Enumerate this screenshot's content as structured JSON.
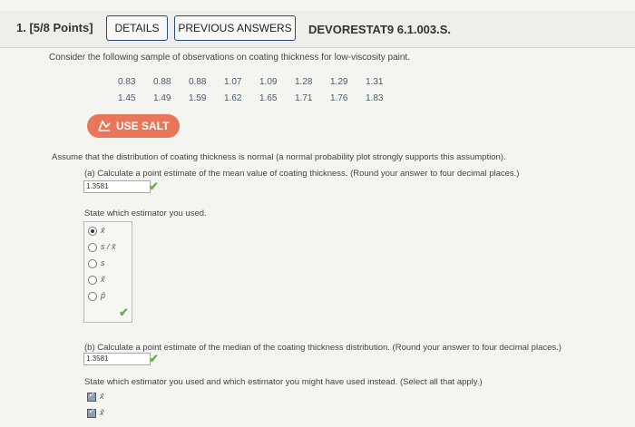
{
  "header": {
    "question_number": "1. [5/8 Points]",
    "details_label": "DETAILS",
    "previous_label": "PREVIOUS ANSWERS",
    "code": "DEVORESTAT9 6.1.003.S."
  },
  "intro": "Consider the following sample of observations on coating thickness for low-viscosity paint.",
  "data_rows": [
    [
      "0.83",
      "0.88",
      "0.88",
      "1.07",
      "1.09",
      "1.28",
      "1.29",
      "1.31"
    ],
    [
      "1.45",
      "1.49",
      "1.59",
      "1.62",
      "1.65",
      "1.71",
      "1.76",
      "1.83"
    ]
  ],
  "salt_label": "USE SALT",
  "assumption": "Assume that the distribution of coating thickness is normal (a normal probability plot strongly supports this assumption).",
  "part_a": {
    "question": "(a) Calculate a point estimate of the mean value of coating thickness. (Round your answer to four decimal places.)",
    "answer": "1.3581",
    "estimator_prompt": "State which estimator you used.",
    "options": [
      "x̄",
      "s / x̄",
      "s",
      "x̃",
      "p̂"
    ],
    "selected_index": 0
  },
  "part_b": {
    "question": "(b) Calculate a point estimate of the median of the coating thickness distribution. (Round your answer to four decimal places.)",
    "answer": "1.3581",
    "estimator_prompt": "State which estimator you used and which estimator you might have used instead. (Select all that apply.)",
    "checked_options": [
      "x̄",
      "x̃"
    ]
  },
  "colors": {
    "salt": "#e8765a",
    "check": "#6cb04a",
    "tab_border": "#2a4b7c"
  }
}
